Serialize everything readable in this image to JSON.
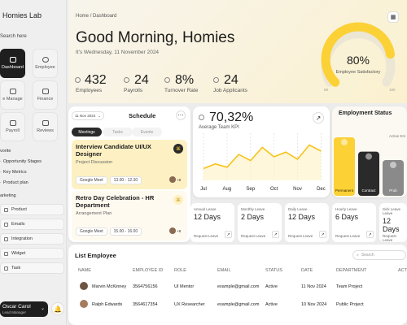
{
  "sidebar": {
    "brand": "Homies Lab",
    "search_label": "Search here",
    "nav": [
      {
        "label": "Dashboard",
        "active": true
      },
      {
        "label": "Employee"
      },
      {
        "label": "e Manage"
      },
      {
        "label": "Finance"
      },
      {
        "label": "Payroll"
      },
      {
        "label": "Reviews"
      }
    ],
    "favorite_title": "vorite",
    "favorites": [
      "Opportunity Stages",
      "Key Metrics",
      "Product plan"
    ],
    "marketing_title": "arketing",
    "marketing": [
      "Product",
      "Emails",
      "Integration",
      "Widget",
      "Task"
    ],
    "user": {
      "name": "Oscar Carol",
      "role": "Lead Manager"
    }
  },
  "breadcrumb": {
    "home": "Home",
    "sep": "/",
    "current": "Dashboard"
  },
  "hero": {
    "greeting": "Good Morning, Homies",
    "date": "It's Wednesday, 11 November 2024",
    "stats": [
      {
        "value": "432",
        "label": "Employees"
      },
      {
        "value": "24",
        "label": "Payrolls"
      },
      {
        "value": "8%",
        "label": "Turnover Rate"
      },
      {
        "value": "24",
        "label": "Job Applicants"
      }
    ],
    "gauge": {
      "value": "80%",
      "label": "Employee Satisfactory",
      "fraction": 0.8,
      "min": "00",
      "max": "100"
    }
  },
  "schedule": {
    "date": "11 Nov 2024",
    "title": "Schedule",
    "tabs": [
      "Meetings",
      "Tasks",
      "Events"
    ],
    "items": [
      {
        "title": "Interview Candidate UI/UX Designer",
        "subtitle": "Project Discussion",
        "platform": "Google Meet",
        "time": "13.00 - 12.30",
        "avatar_count": "+8"
      },
      {
        "title": "Retro Day Celebration - HR Department",
        "subtitle": "Arrangement Plan",
        "platform": "Google Meet",
        "time": "15.00 - 16.00",
        "avatar_count": "+8"
      }
    ]
  },
  "kpi": {
    "value": "70,32%",
    "label": "Average Team KPI"
  },
  "chart_data": {
    "type": "line",
    "categories": [
      "Jul",
      "Aug",
      "Sep",
      "Oct",
      "Nov",
      "Dec"
    ],
    "x": [
      0,
      0.5,
      1,
      1.5,
      2,
      2.5,
      3,
      3.5,
      4,
      4.5,
      5
    ],
    "values": [
      0.25,
      0.35,
      0.28,
      0.55,
      0.42,
      0.7,
      0.5,
      0.6,
      0.45,
      0.75,
      0.62
    ],
    "ylim": [
      0,
      1
    ],
    "grid": true
  },
  "employment": {
    "title": "Employment Status",
    "active_label": "Active Em",
    "bars": [
      {
        "label": "Permanent",
        "value": 0.9,
        "badge": ""
      },
      {
        "label": "Contract",
        "value": 0.68,
        "badge": ""
      },
      {
        "label": "Prob",
        "value": 0.55,
        "badge": ""
      }
    ],
    "colors": [
      "#fbd136",
      "#2a2a2a",
      "#8a8a8a"
    ]
  },
  "leave": [
    {
      "type": "Annual Leave",
      "days": "12 Days",
      "action": "Request Leave"
    },
    {
      "type": "Monthly Leave",
      "days": "2 Days",
      "action": "Request Leave"
    },
    {
      "type": "Daily Leave",
      "days": "12 Days",
      "action": "Request Leave"
    },
    {
      "type": "Hourly Leave",
      "days": "6 Days",
      "action": "Request Leave"
    },
    {
      "type": "Sick Leave Leave",
      "days": "12 Days",
      "action": "Request Leave"
    }
  ],
  "employees": {
    "title": "List Employee",
    "search": "Search",
    "headers": [
      "NAME",
      "EMPLOYEE ID",
      "ROLE",
      "EMAIL",
      "STATUS",
      "DATE",
      "DEPARTMENT",
      "ACTI"
    ],
    "rows": [
      [
        "Marvin McKinney",
        "3564756156",
        "UI Mentor",
        "example@gmail.com",
        "Active",
        "11 Nov 2024",
        "Team Project"
      ],
      [
        "Ralph Edwards",
        "3564617354",
        "UX Researcher",
        "example@gmail.com",
        "Active",
        "10 Nov 2024",
        "Public Project"
      ]
    ]
  }
}
